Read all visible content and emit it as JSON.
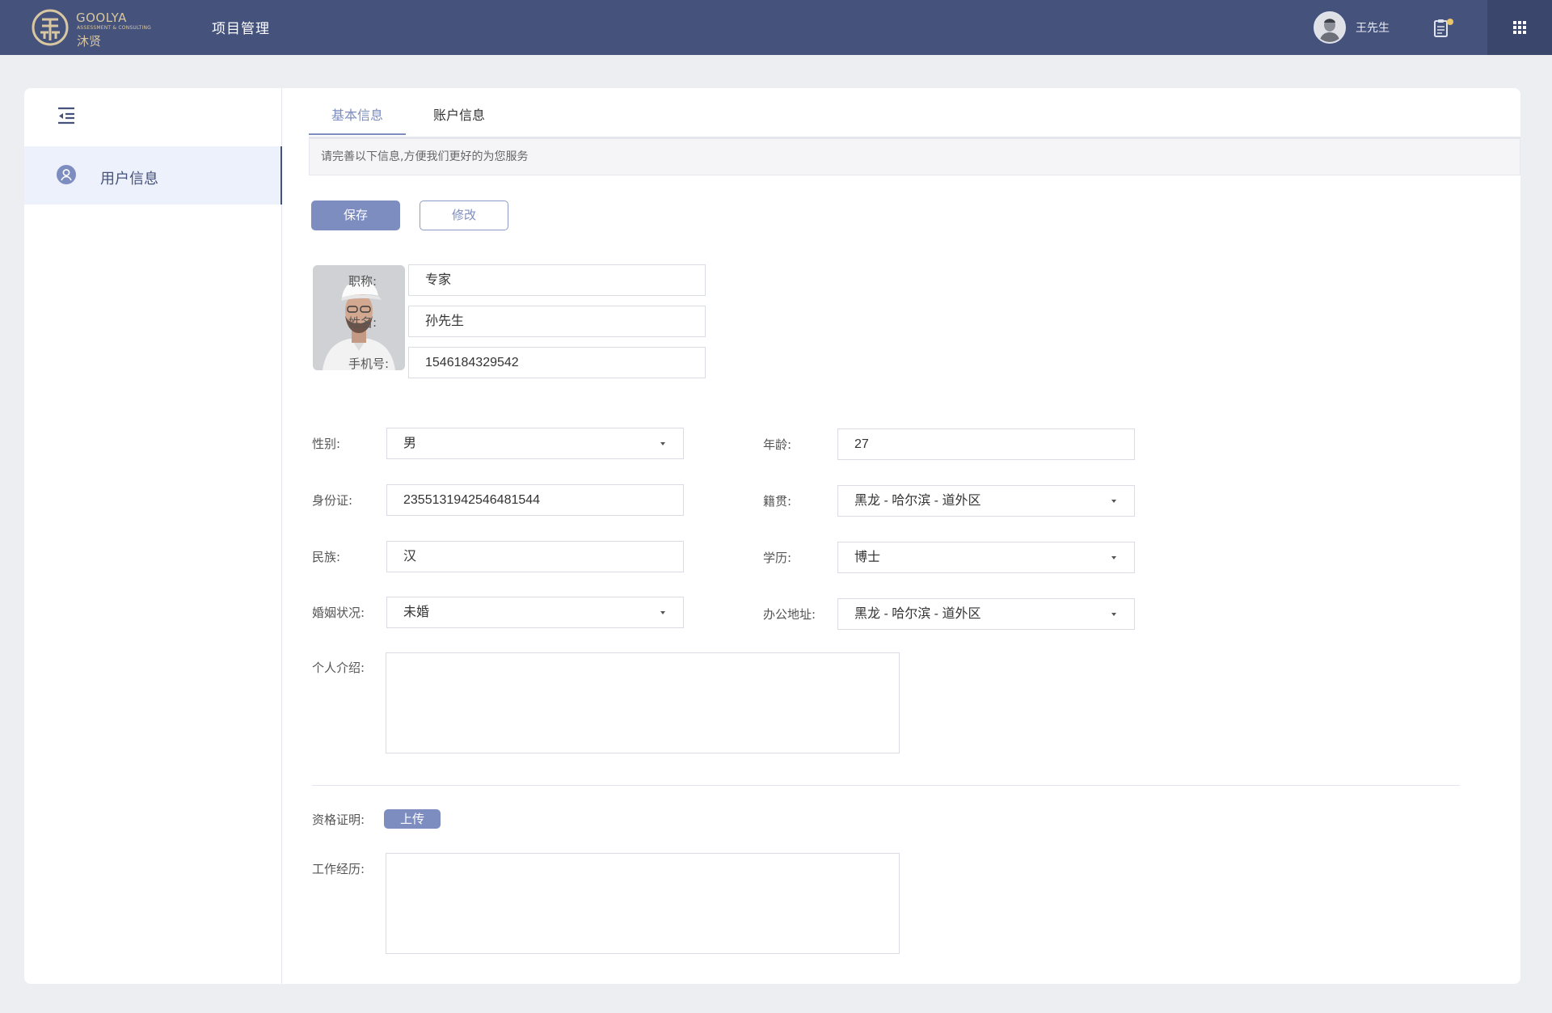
{
  "header": {
    "logo_en": "GOOLYA",
    "logo_sub": "ASSESSMENT & CONSULTING",
    "logo_cn": "沐贤",
    "app_title": "项目管理",
    "user_name": "王先生",
    "icons": {
      "notice": "clipboard-icon",
      "apps": "grid-icon"
    }
  },
  "sidebar": {
    "items": [
      {
        "label": "用户信息",
        "icon": "user-icon",
        "active": true
      }
    ]
  },
  "tabs": [
    {
      "label": "基本信息",
      "active": true
    },
    {
      "label": "账户信息",
      "active": false
    }
  ],
  "tip": "请完善以下信息,方便我们更好的为您服务",
  "buttons": {
    "save": "保存",
    "edit": "修改",
    "upload": "上传"
  },
  "form": {
    "title_label": "职称:",
    "title_value": "专家",
    "name_label": "姓名:",
    "name_value": "孙先生",
    "phone_label": "手机号:",
    "phone_value": "1546184329542",
    "gender_label": "性别:",
    "gender_value": "男",
    "age_label": "年龄:",
    "age_value": "27",
    "id_label": "身份证:",
    "id_value": "2355131942546481544",
    "native_label": "籍贯:",
    "native_value": "黑龙 - 哈尔滨 - 道外区",
    "ethnic_label": "民族:",
    "ethnic_value": "汉",
    "education_label": "学历:",
    "education_value": "博士",
    "marital_label": "婚姻状况:",
    "marital_value": "未婚",
    "office_label": "办公地址:",
    "office_value": "黑龙 - 哈尔滨 - 道外区",
    "intro_label": "个人介绍:",
    "cert_label": "资格证明:",
    "work_label": "工作经历:"
  },
  "colors": {
    "topbar": "#45527b",
    "accent": "#7d8dc0",
    "logo_gold": "#d8c7a0"
  }
}
